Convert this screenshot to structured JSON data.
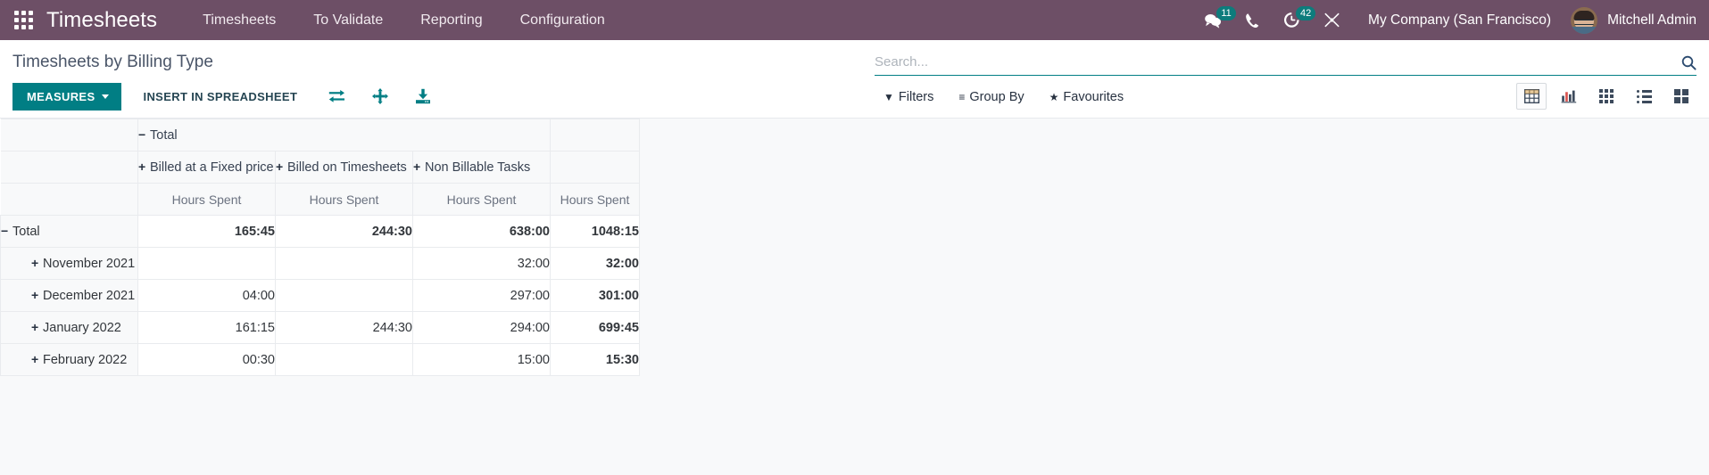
{
  "navbar": {
    "apps_icon": "apps-grid-icon",
    "brand": "Timesheets",
    "menu": [
      {
        "label": "Timesheets"
      },
      {
        "label": "To Validate"
      },
      {
        "label": "Reporting"
      },
      {
        "label": "Configuration"
      }
    ],
    "systray": {
      "messages_icon": "messages-icon",
      "messages_count": "11",
      "phone_icon": "phone-icon",
      "activities_icon": "clock-activities-icon",
      "activities_count": "42",
      "tools_icon": "wrench-cross-icon"
    },
    "company": "My Company (San Francisco)",
    "user_name": "Mitchell Admin",
    "avatar_icon": "user-avatar",
    "accent_color": "#6d4f66",
    "badge_color": "#0d7c7c"
  },
  "control_panel": {
    "title": "Timesheets by Billing Type",
    "measures_label": "MEASURES",
    "insert_spreadsheet_label": "INSERT IN SPREADSHEET",
    "flip_axis_icon": "flip-axis-icon",
    "expand_all_icon": "expand-all-icon",
    "download_icon": "download-xlsx-icon",
    "primary_color": "#017e84"
  },
  "search": {
    "placeholder": "Search...",
    "value": "",
    "search_icon": "search-icon",
    "options": [
      {
        "label": "Filters",
        "icon": "filter-icon",
        "glyph": "▼"
      },
      {
        "label": "Group By",
        "icon": "group-by-icon",
        "glyph": "≡"
      },
      {
        "label": "Favourites",
        "icon": "star-icon",
        "glyph": "★"
      }
    ]
  },
  "view_switcher": {
    "views": [
      {
        "name": "pivot",
        "icon": "pivot-view-icon",
        "active": true
      },
      {
        "name": "graph",
        "icon": "bar-chart-view-icon",
        "active": false
      },
      {
        "name": "kanban",
        "icon": "kanban-view-icon",
        "active": false
      },
      {
        "name": "list",
        "icon": "list-view-icon",
        "active": false
      },
      {
        "name": "blocks",
        "icon": "blocks-view-icon",
        "active": false
      }
    ]
  },
  "chart_data": {
    "type": "table",
    "title": "Timesheets by Billing Type",
    "column_group_root": "Total",
    "column_group_toggle": "−",
    "columns": [
      {
        "label": "Billed at a Fixed price",
        "toggle": "+"
      },
      {
        "label": "Billed on Timesheets",
        "toggle": "+"
      },
      {
        "label": "Non Billable Tasks",
        "toggle": "+"
      },
      {
        "label": "",
        "toggle": ""
      }
    ],
    "measure_label": "Hours Spent",
    "measures": [
      "Hours Spent",
      "Hours Spent",
      "Hours Spent",
      "Hours Spent"
    ],
    "row_header_blank": "",
    "rows": [
      {
        "label": "Total",
        "toggle": "−",
        "level": 0,
        "values": [
          "165:45",
          "244:30",
          "638:00",
          "1048:15"
        ]
      },
      {
        "label": "November 2021",
        "toggle": "+",
        "level": 1,
        "values": [
          "",
          "",
          "32:00",
          "32:00"
        ]
      },
      {
        "label": "December 2021",
        "toggle": "+",
        "level": 1,
        "values": [
          "04:00",
          "",
          "297:00",
          "301:00"
        ]
      },
      {
        "label": "January 2022",
        "toggle": "+",
        "level": 1,
        "values": [
          "161:15",
          "244:30",
          "294:00",
          "699:45"
        ]
      },
      {
        "label": "February 2022",
        "toggle": "+",
        "level": 1,
        "values": [
          "00:30",
          "",
          "15:00",
          "15:30"
        ]
      }
    ]
  }
}
